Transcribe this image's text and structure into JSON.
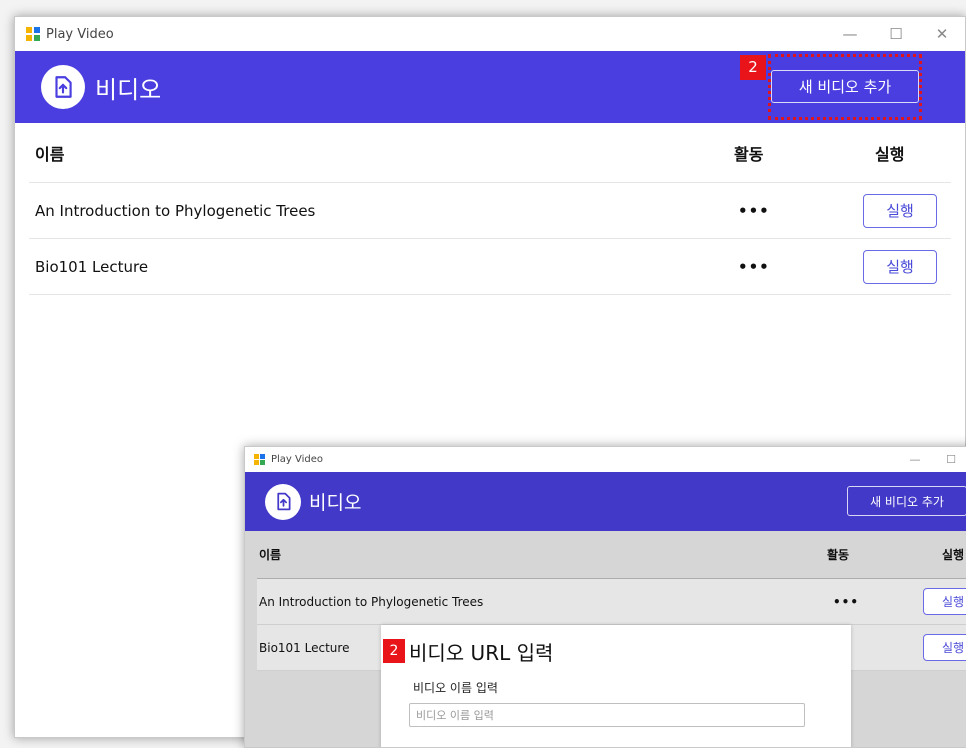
{
  "window1": {
    "title": "Play Video",
    "app_title": "비디오",
    "add_button": "새 비디오 추가",
    "step_badge": "2",
    "columns": {
      "name": "이름",
      "activity": "활동",
      "run": "실행"
    },
    "rows": [
      {
        "name": "An Introduction to Phylogenetic Trees",
        "activity": "•••",
        "run": "실행"
      },
      {
        "name": "Bio101 Lecture",
        "activity": "•••",
        "run": "실행"
      }
    ]
  },
  "window2": {
    "title": "Play Video",
    "app_title": "비디오",
    "add_button": "새 비디오 추가",
    "columns": {
      "name": "이름",
      "activity": "활동",
      "run": "실행"
    },
    "rows": [
      {
        "name": "An Introduction to Phylogenetic Trees",
        "activity": "•••",
        "run": "실행"
      },
      {
        "name": "Bio101 Lecture",
        "activity": "•",
        "run": "실행"
      }
    ],
    "dialog": {
      "step_badge": "2",
      "title": "비디오 URL 입력",
      "name_label": "비디오 이름 입력",
      "name_placeholder": "비디오 이름 입력"
    }
  },
  "colors": {
    "accent": "#4a3ee0",
    "highlight": "#e0151b",
    "badge": "#e8141a"
  },
  "icons": {
    "app": "app-grid-icon",
    "logo": "upload-file-icon",
    "minimize": "minimize-icon",
    "maximize": "maximize-icon",
    "close": "close-icon"
  }
}
